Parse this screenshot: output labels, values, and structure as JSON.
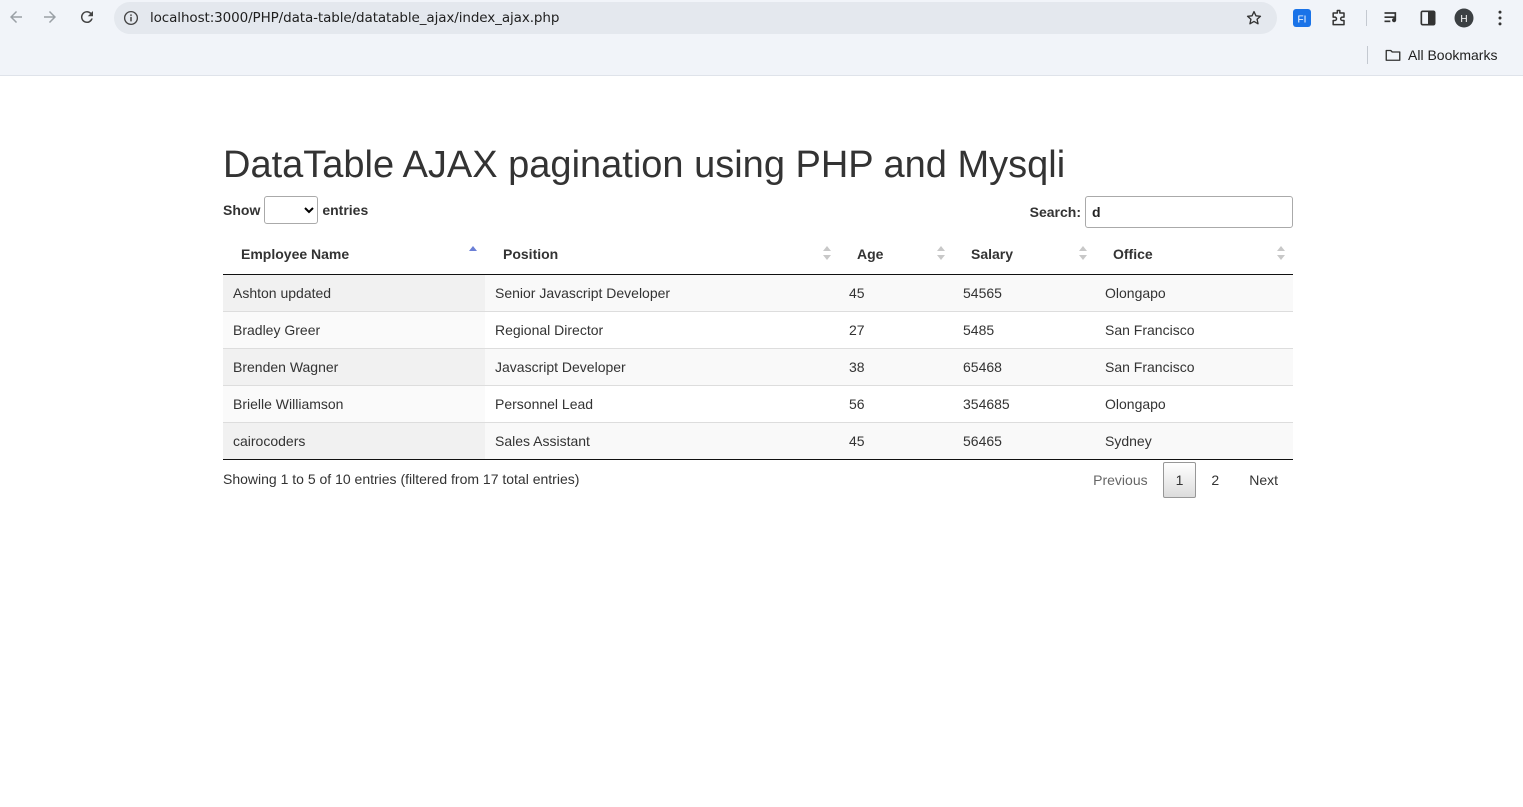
{
  "browser": {
    "url": "localhost:3000/PHP/data-table/datatable_ajax/index_ajax.php",
    "profile_initial": "H",
    "all_bookmarks_label": "All Bookmarks",
    "extension_label": "FI"
  },
  "page": {
    "title": "DataTable AJAX pagination using PHP and Mysqli",
    "length": {
      "prefix": "Show",
      "suffix": "entries",
      "selected": ""
    },
    "search": {
      "label": "Search:",
      "value": "d"
    },
    "table": {
      "columns": [
        {
          "label": "Employee Name",
          "sort": "asc"
        },
        {
          "label": "Position",
          "sort": "none"
        },
        {
          "label": "Age",
          "sort": "none"
        },
        {
          "label": "Salary",
          "sort": "none"
        },
        {
          "label": "Office",
          "sort": "none"
        }
      ],
      "rows": [
        [
          "Ashton updated",
          "Senior Javascript Developer",
          "45",
          "54565",
          "Olongapo"
        ],
        [
          "Bradley Greer",
          "Regional Director",
          "27",
          "5485",
          "San Francisco"
        ],
        [
          "Brenden Wagner",
          "Javascript Developer",
          "38",
          "65468",
          "San Francisco"
        ],
        [
          "Brielle Williamson",
          "Personnel Lead",
          "56",
          "354685",
          "Olongapo"
        ],
        [
          "cairocoders",
          "Sales Assistant",
          "45",
          "56465",
          "Sydney"
        ]
      ]
    },
    "info": "Showing 1 to 5 of 10 entries (filtered from 17 total entries)",
    "pagination": {
      "previous": "Previous",
      "pages": [
        "1",
        "2"
      ],
      "current": "1",
      "next": "Next"
    }
  },
  "colors": {
    "sort_active": "#6b7fd6",
    "sort_inactive": "#c8c8c8",
    "chrome_bg": "#f1f4f9"
  }
}
